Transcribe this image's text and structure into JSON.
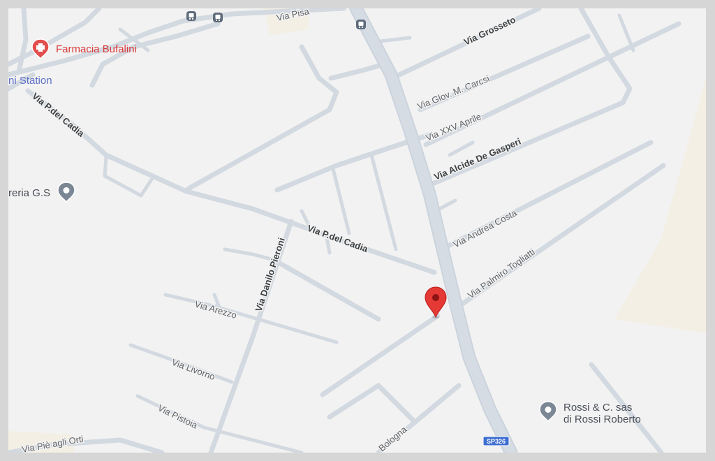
{
  "streets": {
    "via_pisa": "Via Pisa",
    "via_grosseto": "Via Grosseto",
    "via_glov_carcsi": "Via Glov. M. Carcsi",
    "via_xxv_aprile": "Via XXV Aprile",
    "via_alcide_de_gasperi": "Via Alcide De Gasperi",
    "via_andrea_costa": "Via Andrea Costa",
    "via_palmiro_togliatti": "Via Palmiro Togliatti",
    "via_p_del_cadia_1": "Via P.del Cadia",
    "via_p_del_cadia_2": "Via P.del Cadia",
    "via_danilo_pieroni": "Via Danilo Pieroni",
    "via_arezzo": "Via Arezzo",
    "via_livorno": "Via Livorno",
    "via_pistoia": "Via Pistoia",
    "via_pie_agli_orti": "Via Piè agli Orti",
    "bologna": "Bologna"
  },
  "pois": {
    "pharmacy": {
      "label": "Farmacia Bufalini",
      "color": "#d93a3a"
    },
    "station": {
      "label": "ni Station"
    },
    "shop_gs": {
      "label": "reria G.S"
    },
    "business": {
      "line1": "Rossi & C. sas",
      "line2": "di Rossi Roberto"
    }
  },
  "route_shield": {
    "label": "SP326",
    "color": "#3f6fd1"
  },
  "marker": {
    "color": "#e53935"
  },
  "icons": [
    "bus-stop-icon",
    "pharmacy-icon",
    "place-pin-icon",
    "location-marker-icon"
  ]
}
